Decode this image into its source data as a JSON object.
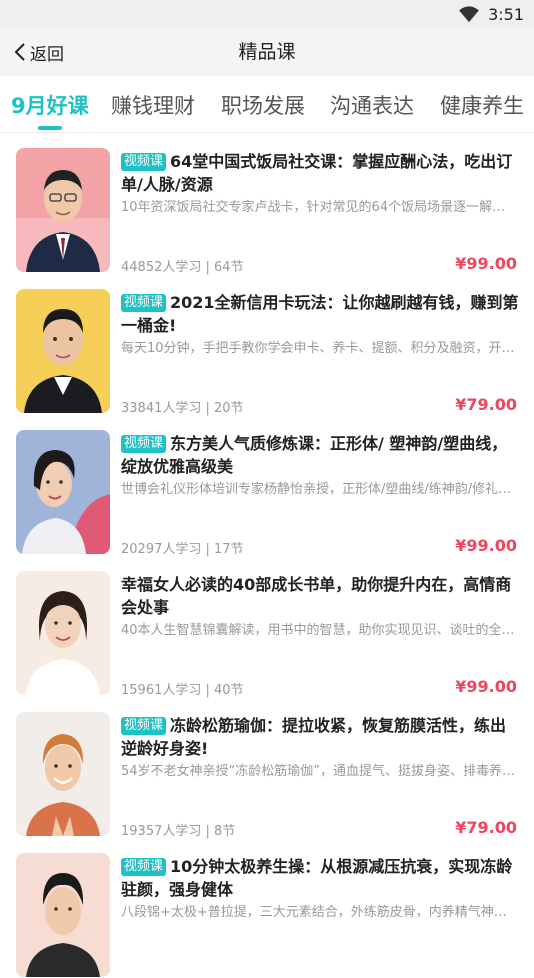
{
  "status_bar": {
    "time": "3:51"
  },
  "header": {
    "back_label": "返回",
    "title": "精品课"
  },
  "tabs": [
    {
      "label": "9月好课",
      "active": true
    },
    {
      "label": "赚钱理财",
      "active": false
    },
    {
      "label": "职场发展",
      "active": false
    },
    {
      "label": "沟通表达",
      "active": false
    },
    {
      "label": "健康养生",
      "active": false
    }
  ],
  "courses": [
    {
      "tag": "视频课",
      "title": "64堂中国式饭局社交课：掌握应酬心法，吃出订单/人脉/资源",
      "desc": "10年资深饭局社交专家卢战卡，针对常见的64个饭局场景逐一解答…",
      "learners": "44852人学习",
      "lessons": "64节",
      "price": "¥99.00"
    },
    {
      "tag": "视频课",
      "title": "2021全新信用卡玩法：让你越刷越有钱，赚到第一桶金!",
      "desc": "每天10分钟，手把手教你学会申卡、养卡、提额、积分及融资，开…",
      "learners": "33841人学习",
      "lessons": "20节",
      "price": "¥79.00"
    },
    {
      "tag": "视频课",
      "title": "东方美人气质修炼课：正形体/ 塑神韵/塑曲线，绽放优雅高级美",
      "desc": "世博会礼仪形体培训专家杨静怡亲授，正形体/塑曲线/练神韵/修礼…",
      "learners": "20297人学习",
      "lessons": "17节",
      "price": "¥99.00"
    },
    {
      "tag": "",
      "title": "幸福女人必读的40部成长书单，助你提升内在，高情商会处事",
      "desc": "40本人生智慧锦囊解读，用书中的智慧，助你实现见识、谈吐的全…",
      "learners": "15961人学习",
      "lessons": "40节",
      "price": "¥99.00"
    },
    {
      "tag": "视频课",
      "title": "冻龄松筋瑜伽：提拉收紧，恢复筋膜活性，练出逆龄好身姿!",
      "desc": "54岁不老女神亲授“冻龄松筋瑜伽”，通血提气、挺拔身姿、排毒养…",
      "learners": "19357人学习",
      "lessons": "8节",
      "price": "¥79.00"
    },
    {
      "tag": "视频课",
      "title": "10分钟太极养生操：从根源减压抗衰，实现冻龄驻颜，强身健体",
      "desc": "八段锦+太极+普拉提，三大元素结合，外练筋皮骨，内养精气神，…",
      "learners": "",
      "lessons": "",
      "price": ""
    }
  ],
  "colors": {
    "accent": "#1ec1c4",
    "price": "#f0455e"
  }
}
